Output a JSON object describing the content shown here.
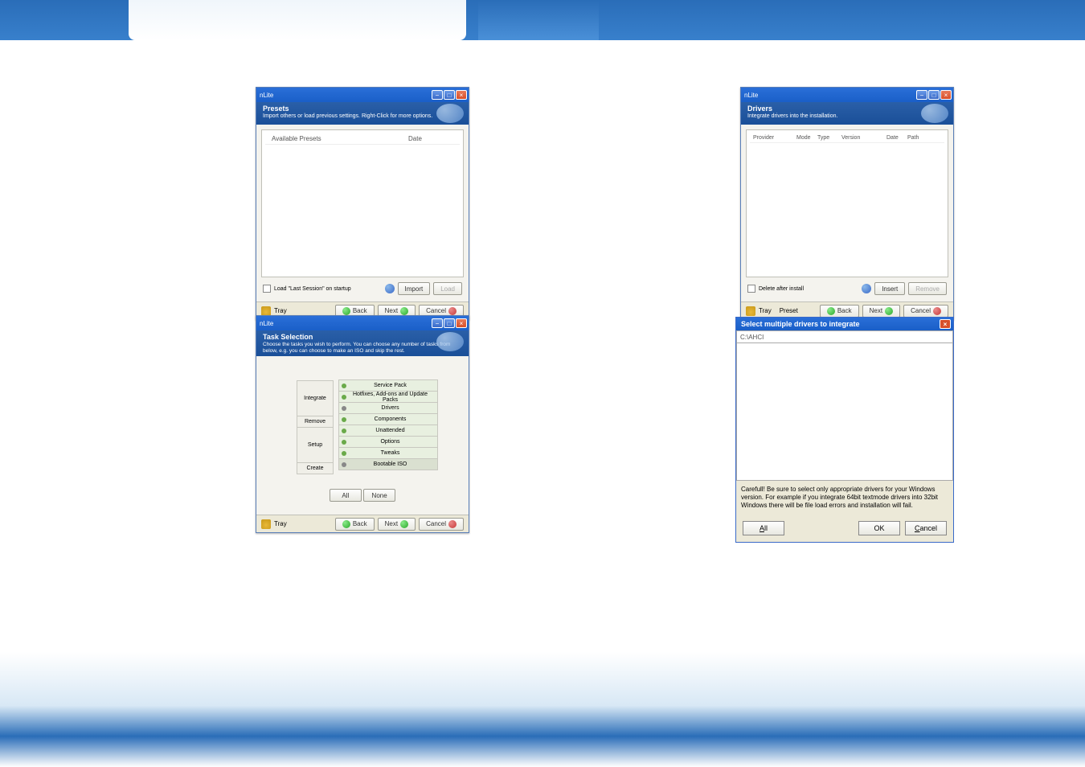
{
  "app_title": "nLite",
  "screens": {
    "presets": {
      "title": "Presets",
      "subtitle": "Import others or load previous settings. Right-Click for more options.",
      "columns": {
        "col1": "Available Presets",
        "col2": "Date"
      },
      "load_last_label": "Load \"Last Session\" on startup",
      "btn_import": "Import",
      "btn_load": "Load"
    },
    "tasks": {
      "title": "Task Selection",
      "subtitle": "Choose the tasks you wish to perform. You can choose any number of tasks from below, e.g. you can choose to make an ISO and skip the rest.",
      "labels": {
        "integrate": "Integrate",
        "remove": "Remove",
        "setup": "Setup",
        "create": "Create"
      },
      "items": {
        "service_pack": "Service Pack",
        "hotfixes": "Hotfixes, Add-ons and Update Packs",
        "drivers": "Drivers",
        "components": "Components",
        "unattended": "Unattended",
        "options": "Options",
        "tweaks": "Tweaks",
        "bootable_iso": "Bootable ISO"
      },
      "btn_all": "All",
      "btn_none": "None"
    },
    "drivers": {
      "title": "Drivers",
      "subtitle": "Integrate drivers into the installation.",
      "columns": {
        "provider": "Provider",
        "mode": "Mode",
        "type": "Type",
        "version": "Version",
        "date": "Date",
        "path": "Path"
      },
      "delete_after_label": "Delete after install",
      "btn_insert": "Insert",
      "btn_remove": "Remove",
      "preset_label": "Preset"
    },
    "select_drivers": {
      "title": "Select multiple drivers to integrate",
      "path": "C:\\AHCI",
      "warning": "Carefull! Be sure to select only appropriate drivers for your Windows version. For example if you integrate 64bit textmode drivers into 32bit Windows there will be file load errors and installation will fail.",
      "btn_all": "All",
      "btn_ok": "OK",
      "btn_cancel": "Cancel"
    }
  },
  "common": {
    "tray": "Tray",
    "back": "Back",
    "next": "Next",
    "cancel": "Cancel"
  }
}
